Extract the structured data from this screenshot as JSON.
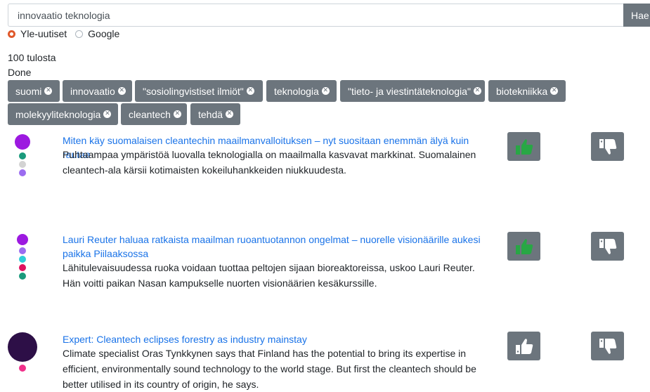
{
  "search": {
    "query": "innovaatio teknologia",
    "button_label": "Hae"
  },
  "sources": [
    {
      "label": "Yle-uutiset",
      "checked": true
    },
    {
      "label": "Google",
      "checked": false
    }
  ],
  "status": {
    "count_text": "100 tulosta",
    "state_text": "Done"
  },
  "tags": [
    "suomi",
    "innovaatio",
    "\"sosiolingvistiset ilmiöt\"",
    "teknologia",
    "\"tieto- ja viestintäteknologia\"",
    "biotekniikka",
    "molekyyliteknologia",
    "cleantech",
    "tehdä"
  ],
  "colors": {
    "accent": "#e0592b",
    "link": "#1a73e8",
    "button": "#6c757d",
    "thumb_active": "#28a745"
  },
  "results": [
    {
      "title": "Miten käy suomalaisen cleantechin maailmanvalloituksen – nyt suositaan enemmän älyä kuin rautaa",
      "description": "Puhtaampaa ympäristöä luovalla teknologialla on maailmalla kasvavat markkinat. Suomalainen cleantech-ala kärsii kotimaisten kokeiluhankkeiden niukkuudesta.",
      "upvoted": true
    },
    {
      "title": "Lauri Reuter haluaa ratkaista maailman ruoantuotannon ongelmat – nuorelle visionäärille aukesi paikka Piilaaksossa",
      "description": "Lähitulevaisuudessa ruoka voidaan tuottaa peltojen sijaan bioreaktoreissa, uskoo Lauri Reuter. Hän voitti paikan Nasan kampukselle nuorten visionäärien kesäkurssille.",
      "upvoted": true
    },
    {
      "title": "Expert: Cleantech eclipses forestry as industry mainstay",
      "description": "Climate specialist Oras Tynkkynen says that Finland has the potential to bring its expertise in efficient, environmentally sound technology to the world stage. But first the cleantech should be better utilised in its country of origin, he says.",
      "upvoted": false
    }
  ]
}
